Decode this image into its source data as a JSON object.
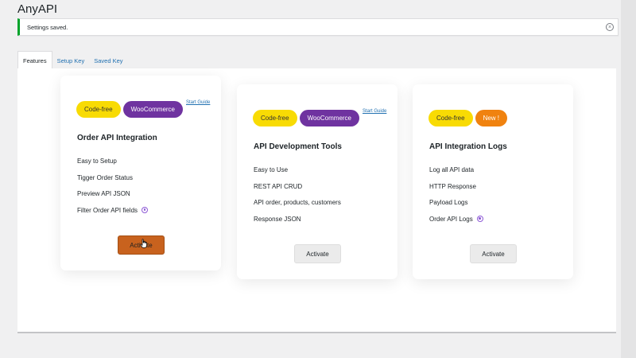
{
  "app": {
    "title": "AnyAPI"
  },
  "notice": {
    "text": "Settings saved.",
    "dismiss_symbol": "×"
  },
  "tabs": [
    {
      "label": "Features",
      "active": true
    },
    {
      "label": "Setup Key",
      "active": false
    },
    {
      "label": "Saved Key",
      "active": false
    }
  ],
  "colors": {
    "notice_success": "#00a32a",
    "link": "#2271b1",
    "badge_codefree": "#f8db04",
    "badge_woocommerce": "#6f33a0",
    "badge_new": "#f0820f",
    "activate_hover": "#c8621e",
    "pro_dot": "#8e5ad6"
  },
  "cards": [
    {
      "badges": [
        "Code-free",
        "WooCommerce"
      ],
      "start_guide": "Start Guide",
      "title": "Order API Integration",
      "features": [
        "Easy to Setup",
        "Tigger Order Status",
        "Preview API JSON",
        "Filter Order API fields"
      ],
      "pro_dot_on": "Filter Order API fields",
      "button": "Activate",
      "button_state": "hover"
    },
    {
      "badges": [
        "Code-free",
        "WooCommerce"
      ],
      "start_guide": "Start Guide",
      "title": "API Development Tools",
      "features": [
        "Easy to Use",
        "REST API CRUD",
        "API order, products, customers",
        "Response JSON"
      ],
      "button": "Activate"
    },
    {
      "badges": [
        "Code-free",
        "New !"
      ],
      "title": "API Integration Logs",
      "features": [
        "Log all API data",
        "HTTP Response",
        "Payload Logs",
        "Order API Logs"
      ],
      "pro_dot_on": "Order API Logs",
      "button": "Activate"
    }
  ]
}
